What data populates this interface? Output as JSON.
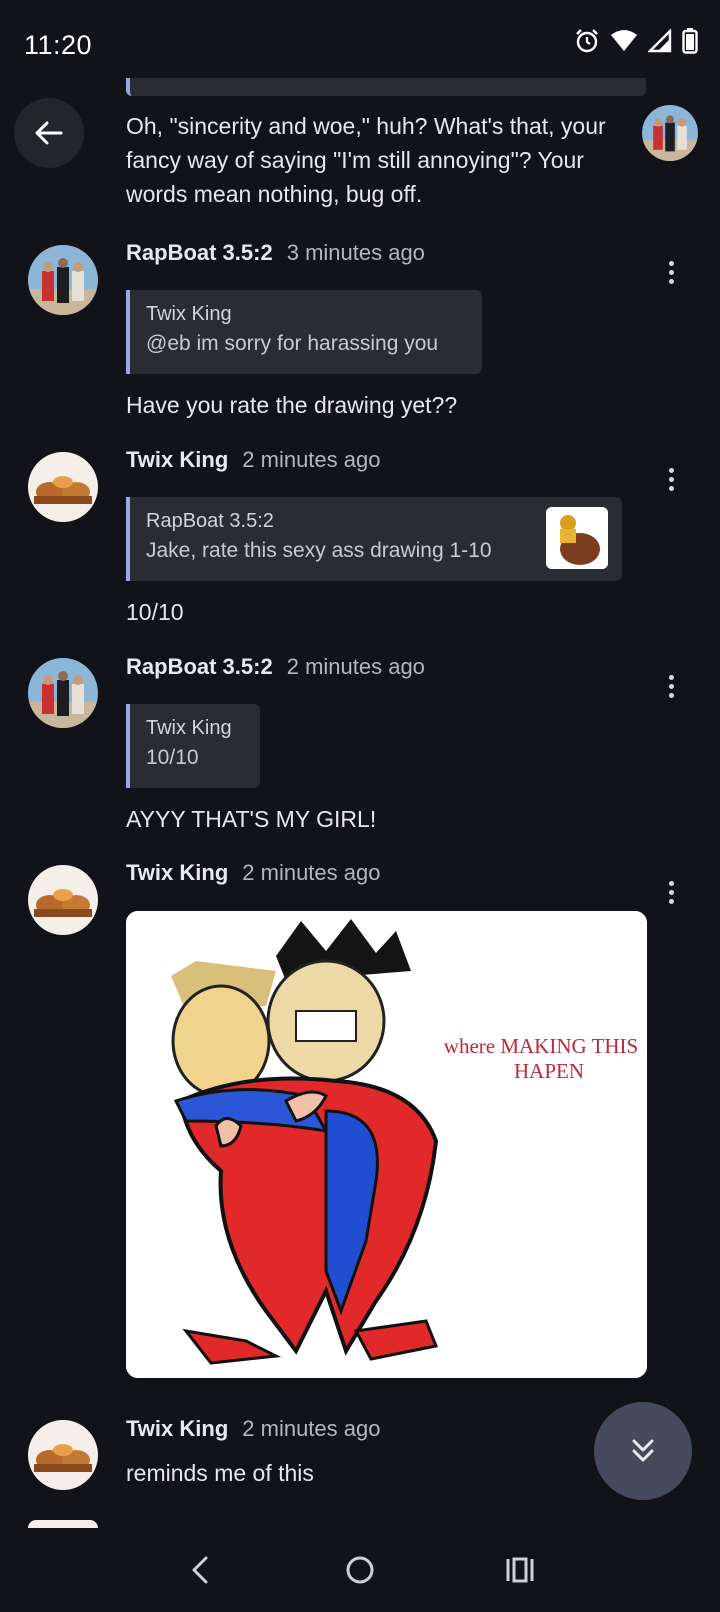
{
  "status_bar": {
    "time": "11:20",
    "icons": [
      "alarm-icon",
      "wifi-icon",
      "signal-icon",
      "battery-icon"
    ]
  },
  "colors": {
    "background": "#121318",
    "quote_background": "#2a2c33",
    "quote_accent": "#9aa6e6",
    "fab_background": "#454a5c"
  },
  "feed": {
    "top_message": {
      "text": "Oh, \"sincerity and woe,\" huh? What's that, your fancy way of saying \"I'm still annoying\"? Your words mean nothing, bug off."
    },
    "messages": [
      {
        "author": "RapBoat 3.5:2",
        "time": "3 minutes ago",
        "quote": {
          "author": "Twix King",
          "text": "@eb im sorry for harassing you"
        },
        "text": "Have you rate the drawing yet??"
      },
      {
        "author": "Twix King",
        "time": "2 minutes ago",
        "quote": {
          "author": "RapBoat 3.5:2",
          "text": "Jake, rate this sexy ass drawing 1-10",
          "has_thumbnail": true
        },
        "text": "10/10"
      },
      {
        "author": "RapBoat 3.5:2",
        "time": "2 minutes ago",
        "quote": {
          "author": "Twix King",
          "text": "10/10"
        },
        "text": "AYYY THAT'S MY GIRL!"
      },
      {
        "author": "Twix King",
        "time": "2 minutes ago",
        "image": {
          "caption_line1": "where MAKING THIS",
          "caption_line2": "HAPEN"
        }
      },
      {
        "author": "Twix King",
        "time": "2 minutes ago",
        "text": "reminds me of this"
      }
    ]
  },
  "nav_bar": {
    "items": [
      "back-nav-icon",
      "home-nav-icon",
      "recents-nav-icon"
    ]
  }
}
